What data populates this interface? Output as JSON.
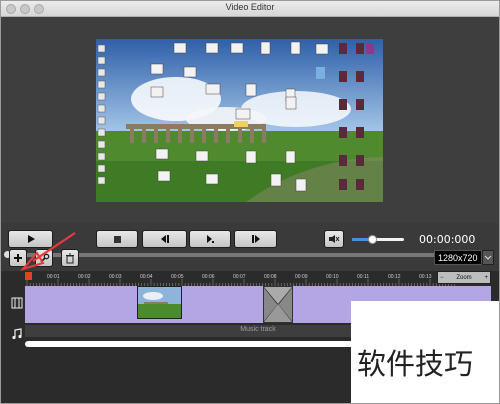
{
  "window": {
    "title": "Video Editor"
  },
  "player": {
    "timecode": "00:00:000",
    "play_icon": "play-icon",
    "stop_icon": "stop-icon",
    "prev_frame_icon": "prev-frame-icon",
    "next_frame_icon": "next-frame-icon",
    "skip_icon": "skip-icon",
    "volume_icon": "speaker-icon",
    "volume_level": 0.35
  },
  "toolbar": {
    "add_icon": "plus-icon",
    "edit_icon": "wrench-icon",
    "delete_icon": "trash-icon",
    "resolution": "1280x720"
  },
  "timeline": {
    "ticks": [
      "00:01",
      "00:02",
      "00:03",
      "00:04",
      "00:05",
      "00:06",
      "00:07",
      "00:08",
      "00:09",
      "00:10",
      "00:11",
      "00:12",
      "00:13"
    ],
    "zoom_label": "Zoom",
    "zoom_minus": "−",
    "zoom_plus": "+",
    "music_track_label": "Music track",
    "video_track_icon": "film-icon",
    "music_track_icon": "music-note-icon"
  },
  "watermark": {
    "text": "软件技巧"
  },
  "colors": {
    "video_track": "#b4a6e4",
    "annotation_arrow": "#e63b3b"
  }
}
